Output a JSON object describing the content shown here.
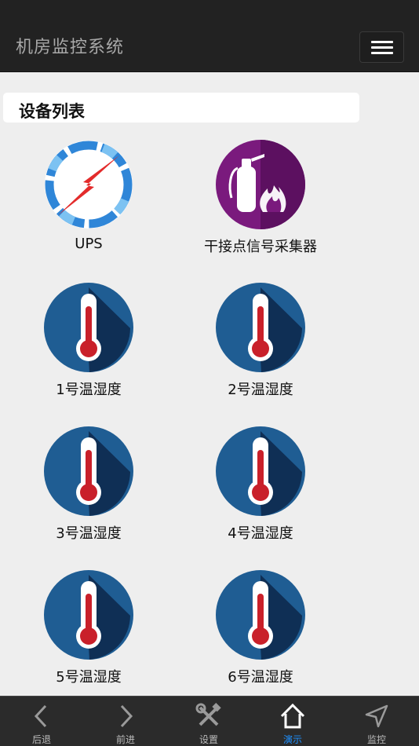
{
  "header": {
    "title": "机房监控系统"
  },
  "section": {
    "title": "设备列表"
  },
  "devices": [
    {
      "label": "UPS",
      "icon": "ups-power-icon"
    },
    {
      "label": "干接点信号采集器",
      "icon": "fire-extinguisher-icon"
    },
    {
      "label": "1号温湿度",
      "icon": "thermometer-icon"
    },
    {
      "label": "2号温湿度",
      "icon": "thermometer-icon"
    },
    {
      "label": "3号温湿度",
      "icon": "thermometer-icon"
    },
    {
      "label": "4号温湿度",
      "icon": "thermometer-icon"
    },
    {
      "label": "5号温湿度",
      "icon": "thermometer-icon"
    },
    {
      "label": "6号温湿度",
      "icon": "thermometer-icon"
    }
  ],
  "nav": {
    "items": [
      {
        "label": "后退",
        "icon": "chevron-left-icon"
      },
      {
        "label": "前进",
        "icon": "chevron-right-icon"
      },
      {
        "label": "设置",
        "icon": "tools-icon"
      },
      {
        "label": "演示",
        "icon": "home-icon"
      },
      {
        "label": "监控",
        "icon": "navigation-arrow-icon"
      }
    ],
    "active_color": "#1e90ff"
  },
  "colors": {
    "header_bg": "#222222",
    "page_bg": "#eeeeee",
    "nav_bg": "#2b2b2b"
  }
}
